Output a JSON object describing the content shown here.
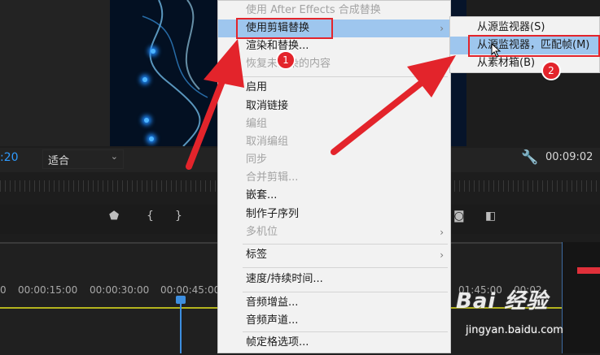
{
  "monitor": {
    "timecode_left": ":20",
    "fit_label": "适合",
    "timecode_right": "00:09:02"
  },
  "timeline": {
    "ruler_labels": [
      "0",
      "00:00:15:00",
      "00:00:30:00",
      "00:00:45:00",
      "01:45:00",
      "00:02"
    ]
  },
  "context_menu": {
    "items": [
      {
        "label": "使用 After Effects 合成替换",
        "disabled": true
      },
      {
        "label": "使用剪辑替换",
        "highlighted": true,
        "submenu": true
      },
      {
        "label": "渲染和替换..."
      },
      {
        "label": "恢复未渲染的内容",
        "disabled": true
      },
      {
        "label": "启用"
      },
      {
        "label": "取消链接"
      },
      {
        "label": "编组",
        "disabled": true
      },
      {
        "label": "取消编组",
        "disabled": true
      },
      {
        "label": "同步",
        "disabled": true
      },
      {
        "label": "合并剪辑...",
        "disabled": true
      },
      {
        "label": "嵌套..."
      },
      {
        "label": "制作子序列"
      },
      {
        "label": "多机位",
        "disabled": true,
        "submenu": true
      },
      {
        "label": "标签",
        "submenu": true
      },
      {
        "label": "速度/持续时间..."
      },
      {
        "label": "音频增益..."
      },
      {
        "label": "音频声道..."
      },
      {
        "label": "帧定格选项..."
      }
    ]
  },
  "submenu": {
    "items": [
      {
        "label": "从源监视器(S)"
      },
      {
        "label": "从源监视器，匹配帧(M)",
        "highlighted": true
      },
      {
        "label": "从素材箱(B)"
      }
    ]
  },
  "annotations": {
    "badge_1": "1",
    "badge_2": "2",
    "color": "#e3242b"
  },
  "watermark": {
    "logo": "Bai 经验",
    "url": "jingyan.baidu.com"
  },
  "icons": [
    "marker-icon",
    "in-point-icon",
    "out-point-icon",
    "wrench-icon",
    "camera-icon",
    "compare-icon",
    "chevron-right-icon",
    "chevron-down-icon",
    "mouse-cursor-icon"
  ]
}
